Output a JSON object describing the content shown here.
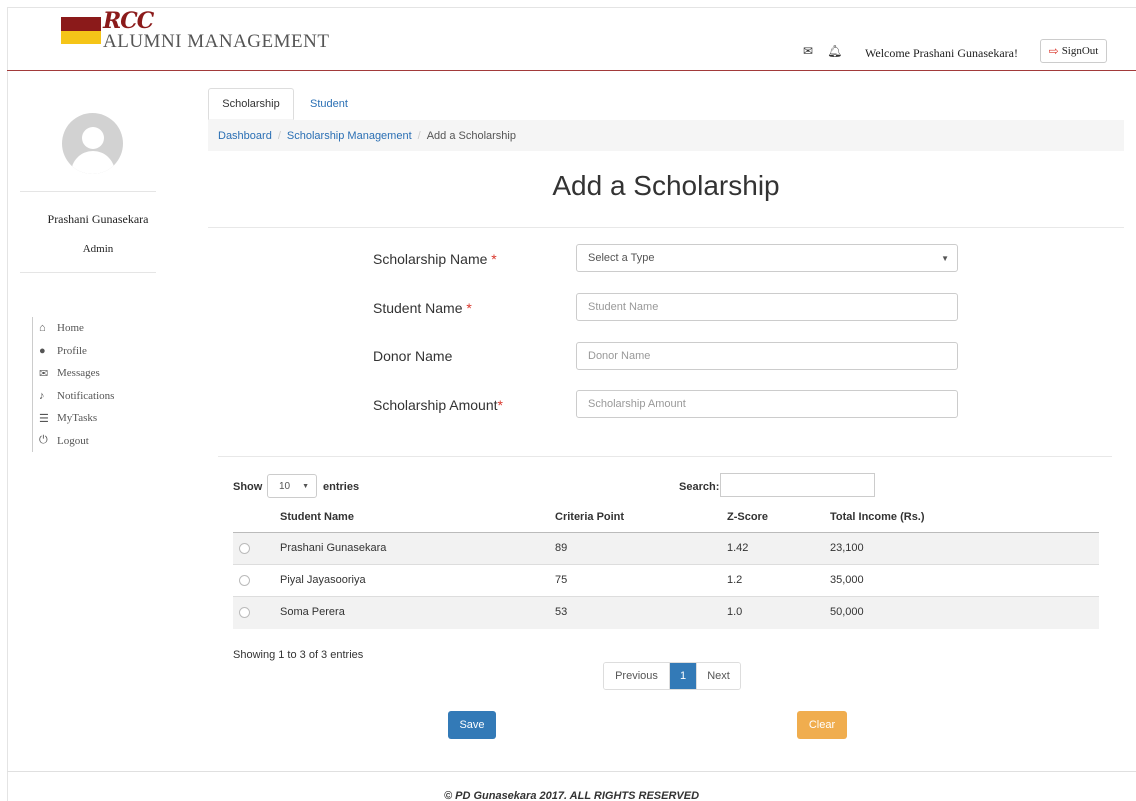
{
  "header": {
    "logo_mark": "RCC",
    "logo_title": "ALUMNI MANAGEMENT",
    "icons": [
      "envelope-icon",
      "bell-icon"
    ],
    "welcome": "Welcome Prashani Gunasekara!",
    "signout": "SignOut"
  },
  "sidebar": {
    "name": "Prashani Gunasekara",
    "role": "Admin",
    "items": [
      {
        "label": "Home",
        "icon": "home-icon"
      },
      {
        "label": "Profile",
        "icon": "user-icon"
      },
      {
        "label": "Messages",
        "icon": "envelope-icon"
      },
      {
        "label": "Notifications",
        "icon": "bell-icon"
      },
      {
        "label": "MyTasks",
        "icon": "list-icon"
      },
      {
        "label": "Logout",
        "icon": "power-icon"
      }
    ]
  },
  "tabs": [
    {
      "label": "Scholarship",
      "active": true
    },
    {
      "label": "Student",
      "active": false
    }
  ],
  "breadcrumb": {
    "items": [
      "Dashboard",
      "Scholarship Management"
    ],
    "current": "Add a Scholarship"
  },
  "page_title": "Add a Scholarship",
  "form": {
    "scholarship_name_label": "Scholarship Name",
    "scholarship_name_value": "Select a Type",
    "student_name_label": "Student Name",
    "student_name_placeholder": "Student Name",
    "donor_name_label": "Donor Name",
    "donor_name_placeholder": "Donor Name",
    "amount_label": "Scholarship Amount",
    "amount_placeholder": "Scholarship Amount",
    "required_mark": "*"
  },
  "table": {
    "show_label": "Show",
    "length_value": "10",
    "entries_label": "entries",
    "search_label": "Search:",
    "columns": [
      "Student Name",
      "Criteria Point",
      "Z-Score",
      "Total Income (Rs.)"
    ],
    "rows": [
      {
        "name": "Prashani Gunasekara",
        "criteria": "89",
        "zscore": "1.42",
        "income": "23,100"
      },
      {
        "name": "Piyal Jayasooriya",
        "criteria": "75",
        "zscore": "1.2",
        "income": "35,000"
      },
      {
        "name": "Soma Perera",
        "criteria": "53",
        "zscore": "1.0",
        "income": "50,000"
      }
    ],
    "info": "Showing 1 to 3 of 3 entries",
    "pager": {
      "previous": "Previous",
      "page": "1",
      "next": "Next"
    }
  },
  "actions": {
    "save": "Save",
    "clear": "Clear"
  },
  "footer": "© PD Gunasekara 2017. ALL RIGHTS RESERVED",
  "colors": {
    "brand_red": "#8b1a1a",
    "brand_yellow": "#f5c518",
    "primary": "#337ab7",
    "warning": "#f0ad4e",
    "required": "#d9362b"
  }
}
